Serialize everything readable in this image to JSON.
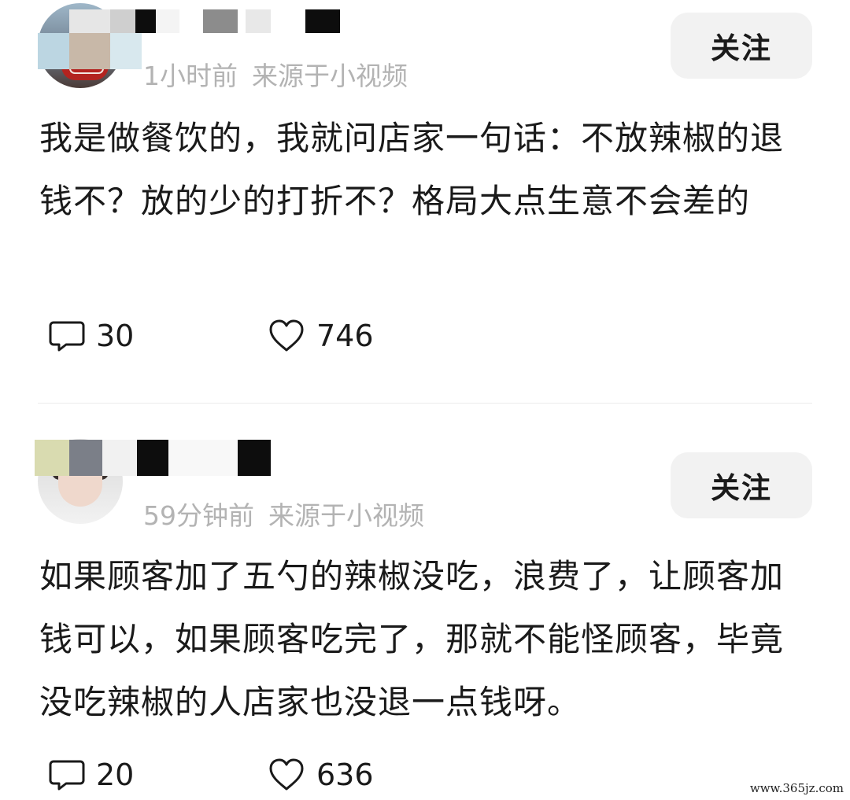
{
  "comments": [
    {
      "time": "1小时前",
      "source": "来源于小视频",
      "follow_label": "关注",
      "text": "我是做餐饮的，我就问店家一句话：不放辣椒的退钱不？放的少的打折不？格局大点生意不会差的",
      "comment_count": "30",
      "like_count": "746"
    },
    {
      "time": "59分钟前",
      "source": "来源于小视频",
      "follow_label": "关注",
      "text": "如果顾客加了五勺的辣椒没吃，浪费了，让顾客加钱可以，如果顾客吃完了，那就不能怪顾客，毕竟没吃辣椒的人店家也没退一点钱呀。",
      "comment_count": "20",
      "like_count": "636"
    }
  ],
  "icons": {
    "comment": "comment-bubble-icon",
    "like": "heart-icon"
  },
  "watermark": "www.365jz.com"
}
